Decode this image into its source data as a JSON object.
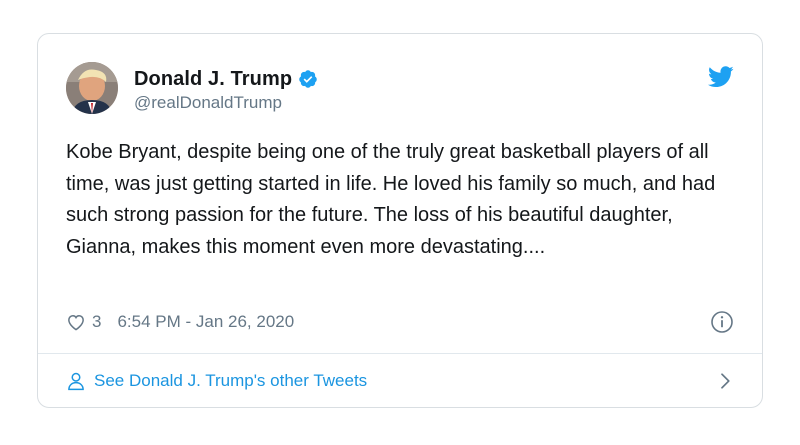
{
  "author": {
    "display_name": "Donald J. Trump",
    "handle": "@realDonaldTrump",
    "verified": true,
    "avatar_icon": "profile-photo"
  },
  "tweet": {
    "text": "Kobe Bryant, despite being one of the truly great basketball players of all time, was just getting started in life. He loved his family so much, and had such strong passion for the future. The loss of his beautiful daughter, Gianna, makes this moment even more devastating...."
  },
  "meta": {
    "like_count": "3",
    "timestamp": "6:54 PM - Jan 26, 2020"
  },
  "footer": {
    "label": "See Donald J. Trump's other Tweets"
  },
  "colors": {
    "accent": "#1da1f2",
    "link": "#1b95e0",
    "secondary_text": "#657786",
    "border": "#d9dee2"
  },
  "icons": [
    "twitter-bird-icon",
    "verified-badge-icon",
    "heart-icon",
    "info-icon",
    "person-icon",
    "chevron-right-icon"
  ]
}
